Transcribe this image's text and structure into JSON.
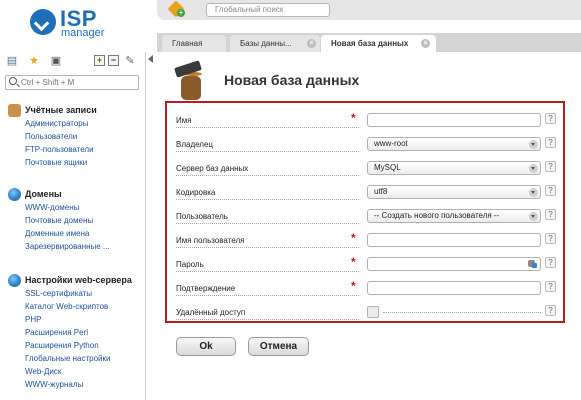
{
  "header": {
    "logo_isp": "ISP",
    "logo_manager": "manager",
    "search_placeholder": "Глобальный поиск"
  },
  "tabs": [
    {
      "label": "Главная",
      "closable": false,
      "active": false
    },
    {
      "label": "Базы данны...",
      "closable": true,
      "active": false
    },
    {
      "label": "Новая база данных",
      "closable": true,
      "active": true
    }
  ],
  "sidebar": {
    "search_placeholder": "Ctrl + Shift + M",
    "sections": [
      {
        "title": "Учётные записи",
        "icon": "users-icon",
        "items": [
          "Администраторы",
          "Пользователи",
          "FTP-пользователи",
          "Почтовые ящики"
        ]
      },
      {
        "title": "Домены",
        "icon": "globe-icon",
        "items": [
          "WWW-домены",
          "Почтовые домены",
          "Доменные имена",
          "Зарезервированные ..."
        ]
      },
      {
        "title": "Настройки web-сервера",
        "icon": "globe-gear-icon",
        "items": [
          "SSL-сертификаты",
          "Каталог Web-скриптов",
          "PHP",
          "Расширения Perl",
          "Расширения Python",
          "Глобальные настройки",
          "Web-Диск",
          "WWW-журналы"
        ]
      }
    ]
  },
  "page": {
    "title": "Новая база данных",
    "icon": "database-tool-icon"
  },
  "form": {
    "fields": [
      {
        "label": "Имя",
        "type": "text",
        "value": "",
        "required": true
      },
      {
        "label": "Владелец",
        "type": "select",
        "value": "www-root",
        "required": false
      },
      {
        "label": "Сервер баз данных",
        "type": "select",
        "value": "MySQL",
        "required": false
      },
      {
        "label": "Кодировка",
        "type": "select",
        "value": "utf8",
        "required": false
      },
      {
        "label": "Пользователь",
        "type": "select",
        "value": "-- Создать нового пользователя --",
        "required": false
      },
      {
        "label": "Имя пользователя",
        "type": "text",
        "value": "",
        "required": true
      },
      {
        "label": "Пароль",
        "type": "password",
        "value": "",
        "required": true
      },
      {
        "label": "Подтверждение",
        "type": "password",
        "value": "",
        "required": true
      },
      {
        "label": "Удалённый доступ",
        "type": "checkbox",
        "value": "",
        "required": false
      }
    ],
    "help_label": "?",
    "required_mark": "*"
  },
  "buttons": {
    "ok": "Ok",
    "cancel": "Отмена"
  },
  "colors": {
    "brand": "#1d6fb8",
    "form_border": "#b51d1d",
    "required": "#c01c1c",
    "link": "#1f4f9e"
  }
}
